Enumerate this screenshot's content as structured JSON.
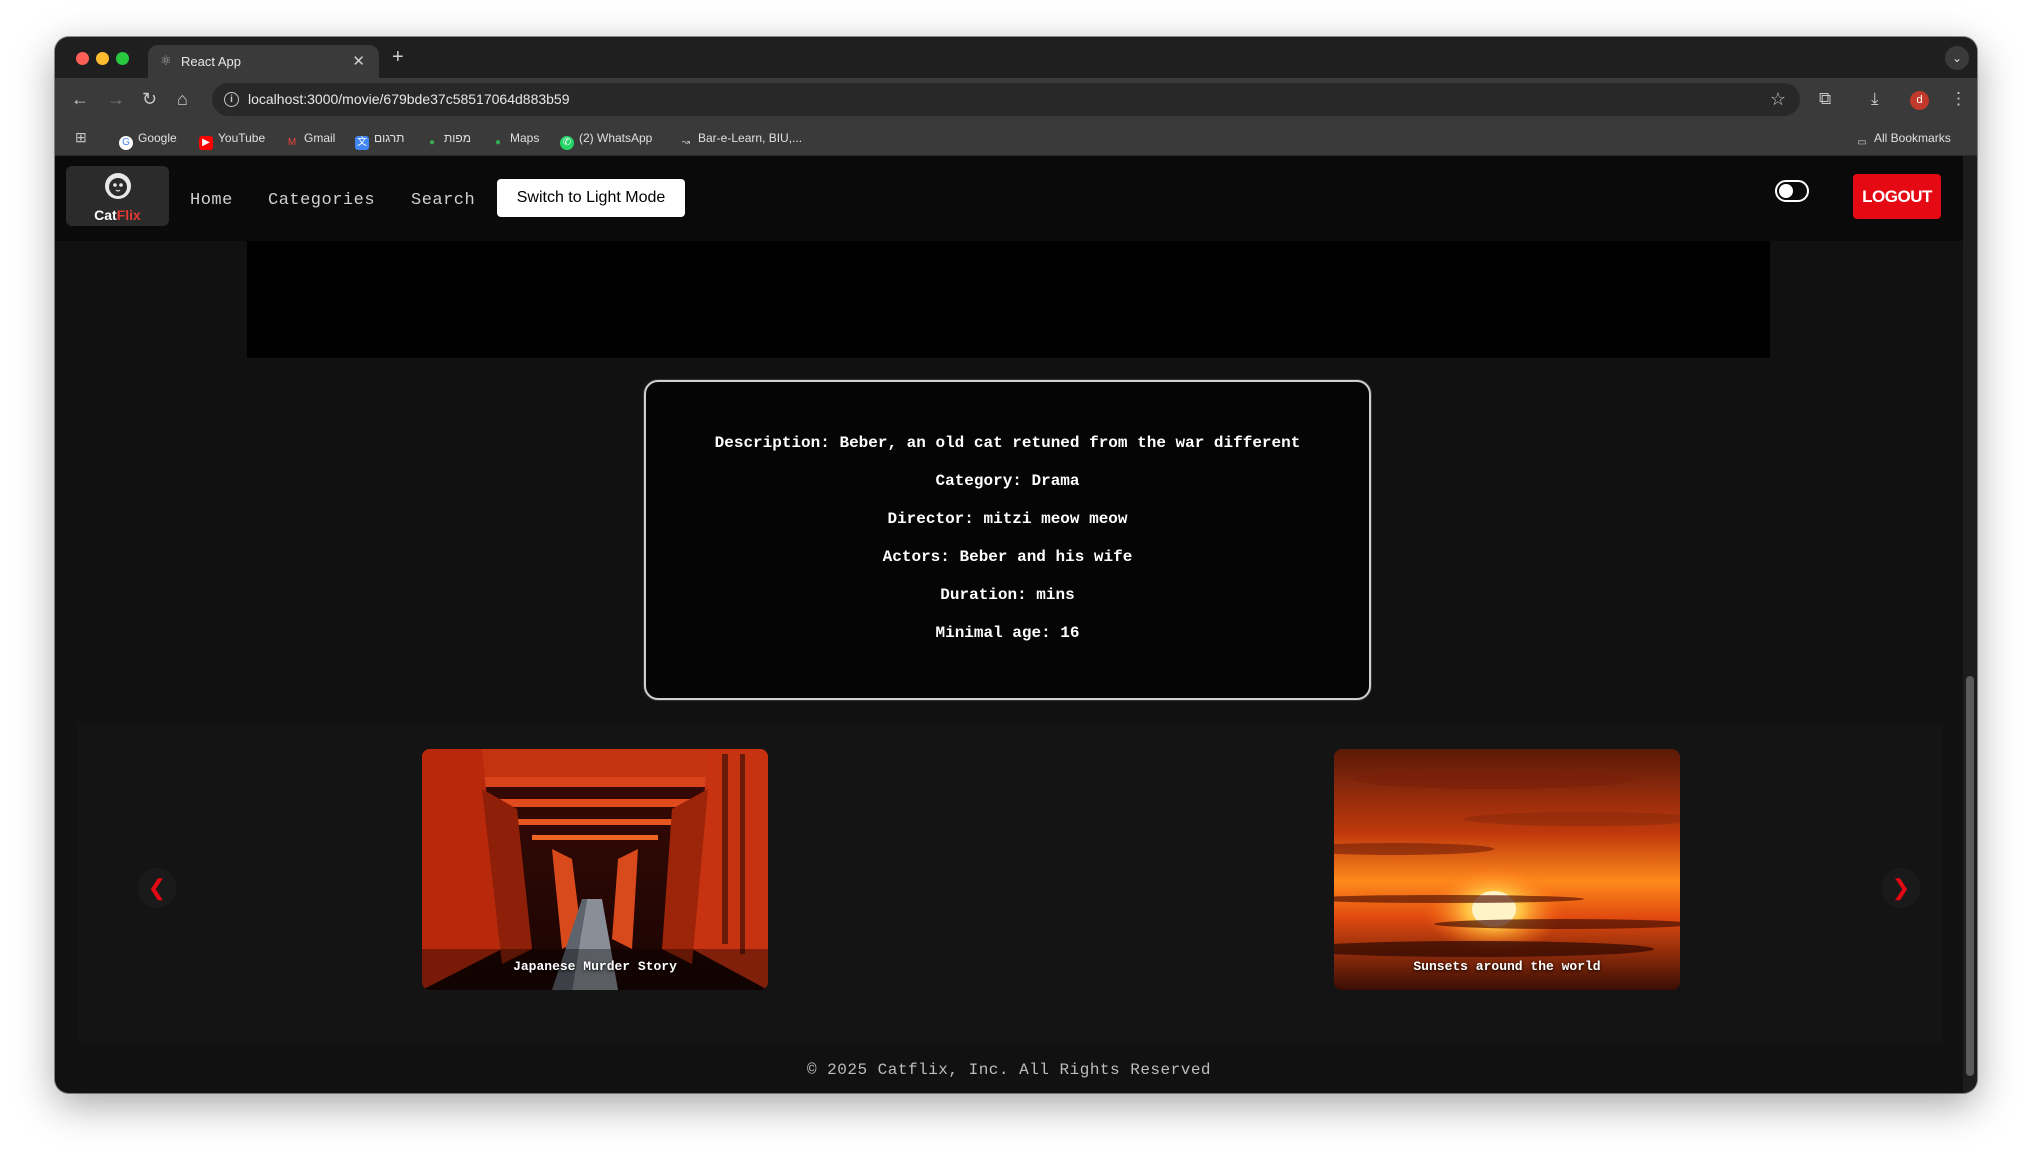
{
  "browser": {
    "tab_title": "React App",
    "url": "localhost:3000/movie/679bde37c58517064d883b59",
    "bookmarks": [
      "Google",
      "YouTube",
      "Gmail",
      "תרגום",
      "מפות",
      "Maps",
      "(2) WhatsApp",
      "Bar-e-Learn, BIU,..."
    ],
    "all_bookmarks": "All Bookmarks",
    "profile_initial": "d"
  },
  "nav": {
    "logo_main": "Cat",
    "logo_accent": "Flix",
    "links": [
      "Home",
      "Categories",
      "Search"
    ],
    "mode_button": "Switch to Light Mode",
    "logout": "LOGOUT"
  },
  "details": {
    "description": "Description: Beber, an old cat retuned from the war different",
    "category": "Category: Drama",
    "director": "Director: mitzi meow meow",
    "actors": "Actors: Beber and his wife",
    "duration": "Duration: mins",
    "minimal_age": "Minimal age: 16"
  },
  "carousel": {
    "prev": "❮",
    "next": "❯",
    "cards": [
      "Japanese Murder Story",
      "Sunsets around the world"
    ]
  },
  "footer": "© 2025 Catflix, Inc. All Rights Reserved",
  "colors": {
    "accent_red": "#e50914",
    "page_bg": "#111111"
  }
}
